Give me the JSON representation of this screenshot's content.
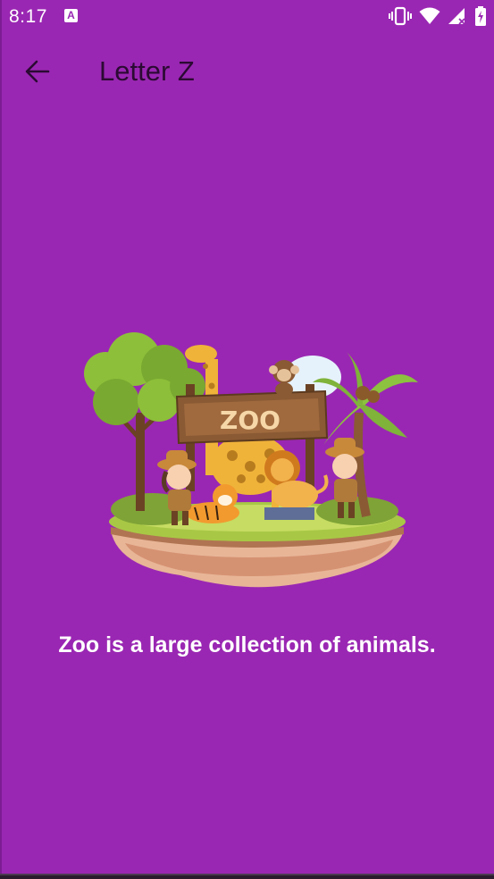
{
  "status_bar": {
    "time": "8:17",
    "app_icon": {
      "icon": "a-box-icon",
      "letter": "A"
    },
    "icons": [
      "vibrate-icon",
      "wifi-icon",
      "signal-icon",
      "battery-icon"
    ]
  },
  "app_bar": {
    "back_icon": "arrow-left-icon",
    "title": "Letter Z"
  },
  "illustration": {
    "sign_text": "ZOO"
  },
  "content": {
    "caption": "Zoo is a large collection of animals."
  },
  "colors": {
    "background": "#9a27b3",
    "title_text": "#2b0a33",
    "caption_text": "#ffffff"
  }
}
